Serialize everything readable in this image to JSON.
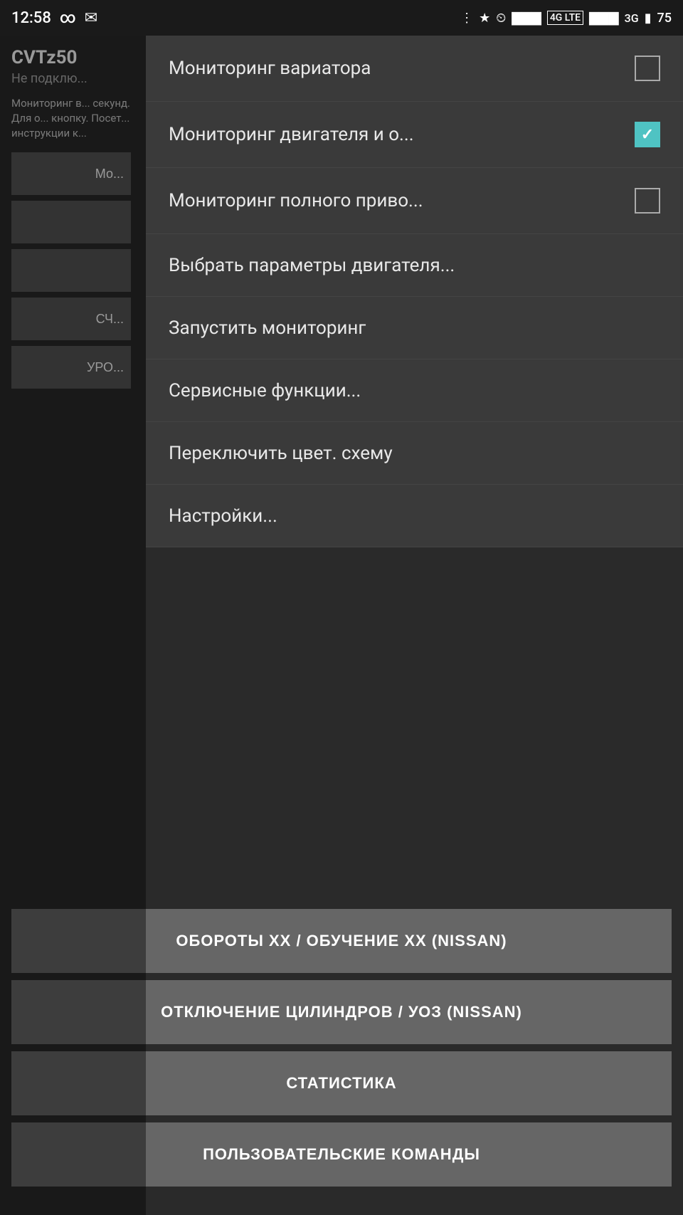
{
  "statusBar": {
    "time": "12:58",
    "battery": "75",
    "icons": [
      "bluetooth",
      "clock",
      "signal1",
      "signal2",
      "signal3",
      "battery"
    ]
  },
  "leftPanel": {
    "title": "CVTz50",
    "subtitle": "Не подклю...",
    "description": "Мониторинг в... секунд. Для о... кнопку. Посет... инструкции к...",
    "buttons": [
      "Мо...",
      "",
      "",
      "СЧ...",
      "УРО..."
    ]
  },
  "menu": {
    "items": [
      {
        "id": "monitoring-variator",
        "label": "Мониторинг вариатора",
        "hasCheckbox": true,
        "checked": false
      },
      {
        "id": "monitoring-engine",
        "label": "Мониторинг двигателя и о...",
        "hasCheckbox": true,
        "checked": true
      },
      {
        "id": "monitoring-full",
        "label": "Мониторинг полного приво...",
        "hasCheckbox": true,
        "checked": false
      },
      {
        "id": "select-params",
        "label": "Выбрать параметры двигателя...",
        "hasCheckbox": false,
        "checked": false
      },
      {
        "id": "start-monitoring",
        "label": "Запустить мониторинг",
        "hasCheckbox": false,
        "checked": false
      },
      {
        "id": "service-functions",
        "label": "Сервисные функции...",
        "hasCheckbox": false,
        "checked": false
      },
      {
        "id": "switch-color",
        "label": "Переключить цвет. схему",
        "hasCheckbox": false,
        "checked": false
      },
      {
        "id": "settings",
        "label": "Настройки...",
        "hasCheckbox": false,
        "checked": false
      }
    ]
  },
  "bottomButtons": [
    {
      "id": "idle-rpm",
      "label": "ОБОРОТЫ ХХ / ОБУЧЕНИЕ ХХ (NISSAN)"
    },
    {
      "id": "cylinder-off",
      "label": "ОТКЛЮЧЕНИЕ ЦИЛИНДРОВ / УОЗ (NISSAN)"
    },
    {
      "id": "statistics",
      "label": "СТАТИСТИКА"
    },
    {
      "id": "user-commands",
      "label": "ПОЛЬЗОВАТЕЛЬСКИЕ КОМАНДЫ"
    }
  ]
}
